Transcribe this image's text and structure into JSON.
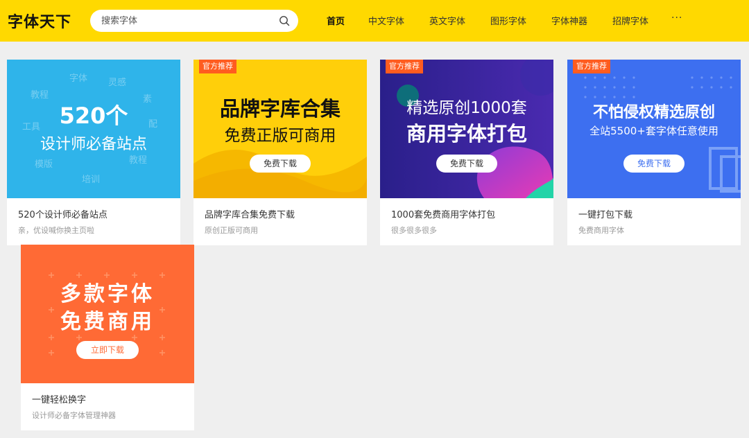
{
  "header": {
    "logo": "字体天下",
    "search_placeholder": "搜索字体",
    "nav": [
      "首页",
      "中文字体",
      "英文字体",
      "图形字体",
      "字体神器",
      "招牌字体"
    ],
    "more": "···"
  },
  "cards": [
    {
      "title": "520个设计师必备站点",
      "subtitle": "亲，优设喊你换主页啦",
      "banner": {
        "line1": "520个",
        "line2": "设计师必备站点",
        "words": [
          "字体",
          "灵感",
          "教程",
          "素",
          "工具",
          "配",
          "模版",
          "教程",
          "培训"
        ]
      }
    },
    {
      "title": "品牌字库合集免费下载",
      "subtitle": "原创正版可商用",
      "badge": "官方推荐",
      "banner": {
        "line1": "品牌字库合集",
        "line2": "免费正版可商用",
        "button": "免费下载"
      }
    },
    {
      "title": "1000套免费商用字体打包",
      "subtitle": "很多很多很多",
      "badge": "官方推荐",
      "banner": {
        "line1": "精选原创1000套",
        "line2": "商用字体打包",
        "button": "免费下载"
      }
    },
    {
      "title": "一键打包下载",
      "subtitle": "免费商用字体",
      "badge": "官方推荐",
      "banner": {
        "line1": "不怕侵权精选原创",
        "line2": "全站5500+套字体任意使用",
        "button": "免费下载"
      }
    },
    {
      "title": "一键轻松换字",
      "subtitle": "设计师必备字体管理神器",
      "banner": {
        "line1": "多款字体",
        "line2": "免费商用",
        "button": "立即下载"
      }
    }
  ],
  "colors": {
    "header_bg": "#ffd900",
    "badge": "#ff5c1f",
    "card1_bg": "#2fb4ea",
    "card2_bg": "#ffcf0a",
    "card3_bg": "#1b1a6b",
    "card4_bg": "#3d6ff0",
    "card5_bg": "#ff6a35"
  }
}
